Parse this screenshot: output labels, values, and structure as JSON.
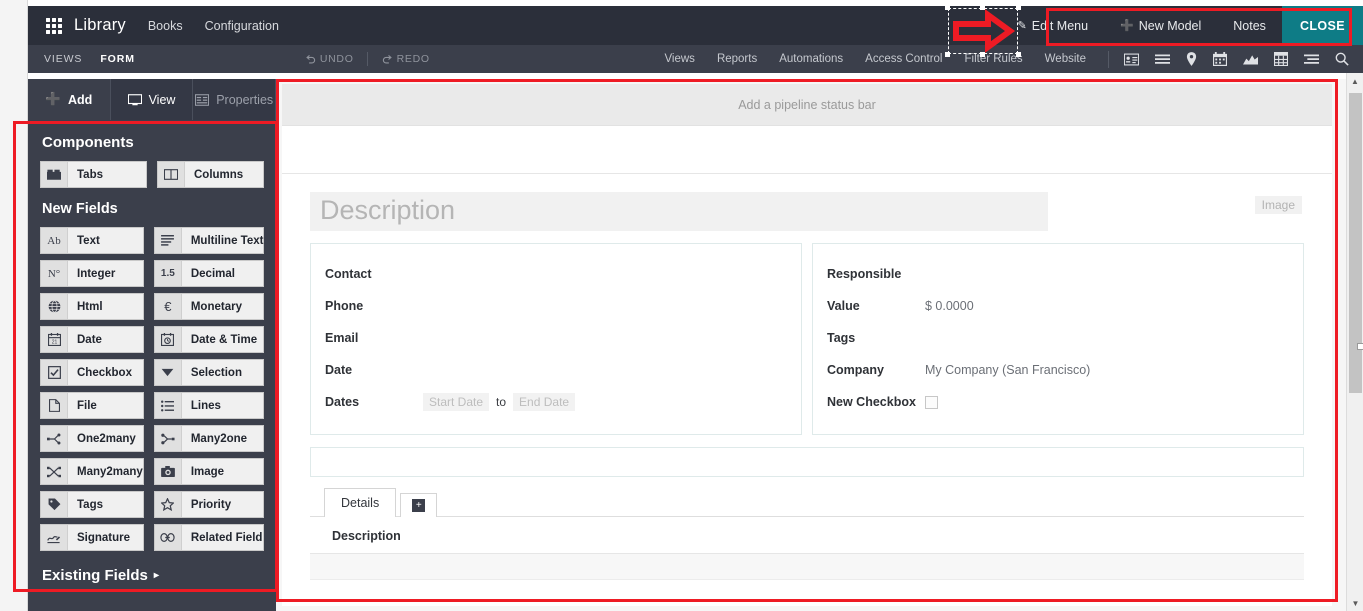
{
  "navbar": {
    "apps_icon": "apps-grid-icon",
    "brand": "Library",
    "links": [
      "Books",
      "Configuration"
    ],
    "edit_menu": "Edit Menu",
    "edit_menu_icon": "pencil-icon",
    "new_model": "New Model",
    "new_model_icon": "plus-icon",
    "notes": "Notes",
    "close": "CLOSE",
    "close_bg": "#0e7c86",
    "bg": "#2b2f3a"
  },
  "subbar": {
    "views": "VIEWS",
    "form": "FORM",
    "undo": "UNDO",
    "undo_icon": "undo-arrow-icon",
    "redo": "REDO",
    "redo_icon": "redo-arrow-icon",
    "links": [
      "Views",
      "Reports",
      "Automations",
      "Access Control",
      "Filter Rules",
      "Website"
    ],
    "icons": [
      "kanban-card-icon",
      "list-icon",
      "map-pin-icon",
      "calendar-icon",
      "activity-graph-icon",
      "pivot-grid-icon",
      "gantt-icon",
      "search-icon"
    ],
    "bg": "#3b3f4b"
  },
  "leftpanel": {
    "tabs": [
      {
        "label": "Add",
        "icon": "plus-icon",
        "selected": true
      },
      {
        "label": "View",
        "icon": "monitor-icon",
        "selected": false
      },
      {
        "label": "Properties",
        "icon": "properties-icon",
        "selected": false
      }
    ],
    "components_heading": "Components",
    "components": [
      {
        "label": "Tabs",
        "icon": "tabs-icon"
      },
      {
        "label": "Columns",
        "icon": "columns-icon"
      }
    ],
    "new_fields_heading": "New Fields",
    "new_fields": [
      {
        "label": "Text",
        "icon": "ab-text-icon"
      },
      {
        "label": "Multiline Text",
        "icon": "multiline-text-icon"
      },
      {
        "label": "Integer",
        "icon": "number-icon"
      },
      {
        "label": "Decimal",
        "icon": "decimal-icon"
      },
      {
        "label": "Html",
        "icon": "globe-icon"
      },
      {
        "label": "Monetary",
        "icon": "euro-icon"
      },
      {
        "label": "Date",
        "icon": "calendar-icon"
      },
      {
        "label": "Date & Time",
        "icon": "clock-calendar-icon"
      },
      {
        "label": "Checkbox",
        "icon": "checkbox-icon"
      },
      {
        "label": "Selection",
        "icon": "dropdown-triangle-icon"
      },
      {
        "label": "File",
        "icon": "file-icon"
      },
      {
        "label": "Lines",
        "icon": "lines-list-icon"
      },
      {
        "label": "One2many",
        "icon": "one2many-icon"
      },
      {
        "label": "Many2one",
        "icon": "many2one-icon"
      },
      {
        "label": "Many2many",
        "icon": "many2many-icon"
      },
      {
        "label": "Image",
        "icon": "camera-icon"
      },
      {
        "label": "Tags",
        "icon": "tag-icon"
      },
      {
        "label": "Priority",
        "icon": "star-icon"
      },
      {
        "label": "Signature",
        "icon": "signature-icon"
      },
      {
        "label": "Related Field",
        "icon": "link-chain-icon"
      }
    ],
    "existing_fields": "Existing Fields",
    "existing_fields_caret": "▸"
  },
  "canvas": {
    "status_bar_placeholder": "Add a pipeline status bar",
    "description_title": "Description",
    "image_placeholder": "Image",
    "left_column": [
      {
        "label": "Contact",
        "value": ""
      },
      {
        "label": "Phone",
        "value": ""
      },
      {
        "label": "Email",
        "value": ""
      },
      {
        "label": "Date",
        "value": ""
      },
      {
        "label": "Dates",
        "value": "",
        "start_placeholder": "Start Date",
        "separator": "to",
        "end_placeholder": "End Date"
      }
    ],
    "right_column": [
      {
        "label": "Responsible",
        "value": ""
      },
      {
        "label": "Value",
        "value": "$ 0.0000"
      },
      {
        "label": "Tags",
        "value": ""
      },
      {
        "label": "Company",
        "value": "My Company (San Francisco)"
      },
      {
        "label": "New Checkbox",
        "value": "",
        "checkbox": true
      }
    ],
    "tabs": [
      {
        "label": "Details",
        "active": true
      }
    ],
    "add_tab_icon": "plus-square-icon",
    "details_column_header": "Description"
  },
  "annotations": {
    "arrow_icon": "red-right-arrow-annotation",
    "highlight_color": "#ee1b24"
  },
  "scrollbar": {
    "up_icon": "caret-up-icon",
    "down_icon": "caret-down-icon"
  }
}
